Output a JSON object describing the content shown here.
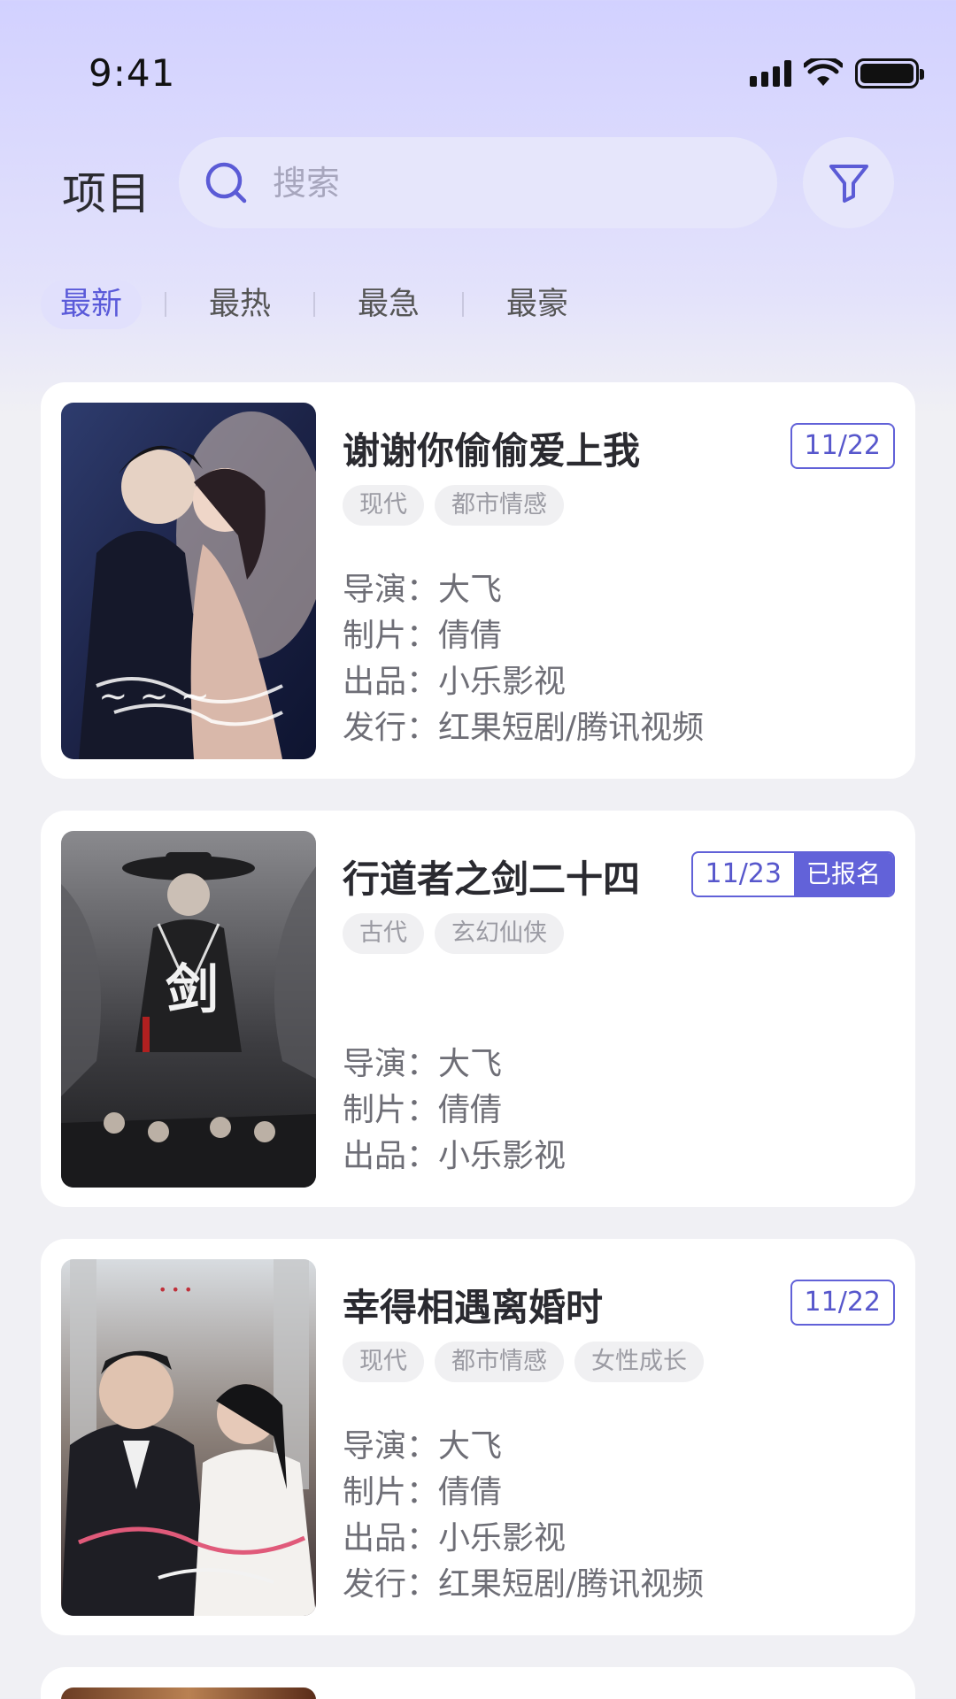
{
  "status_bar": {
    "time": "9:41"
  },
  "header": {
    "title": "项目",
    "search_placeholder": "搜索"
  },
  "tabs": [
    {
      "label": "最新",
      "active": true
    },
    {
      "label": "最热",
      "active": false
    },
    {
      "label": "最急",
      "active": false
    },
    {
      "label": "最豪",
      "active": false
    }
  ],
  "projects": [
    {
      "title": "谢谢你偷偷爱上我",
      "date": "11/22",
      "status": "",
      "tags": [
        "现代",
        "都市情感"
      ],
      "director_label": "导演：",
      "director": "大飞",
      "producer_label": "制片：",
      "producer": "倩倩",
      "studio_label": "出品：",
      "studio": "小乐影视",
      "distributor_label": "发行：",
      "distributor": "红果短剧/腾讯视频"
    },
    {
      "title": "行道者之剑二十四",
      "date": "11/23",
      "status": "已报名",
      "tags": [
        "古代",
        "玄幻仙侠"
      ],
      "director_label": "导演：",
      "director": "大飞",
      "producer_label": "制片：",
      "producer": "倩倩",
      "studio_label": "出品：",
      "studio": "小乐影视"
    },
    {
      "title": "幸得相遇离婚时",
      "date": "11/22",
      "status": "",
      "tags": [
        "现代",
        "都市情感",
        "女性成长"
      ],
      "director_label": "导演：",
      "director": "大飞",
      "producer_label": "制片：",
      "producer": "倩倩",
      "studio_label": "出品：",
      "studio": "小乐影视",
      "distributor_label": "发行：",
      "distributor": "红果短剧/腾讯视频"
    }
  ],
  "colors": {
    "accent": "#6262d9",
    "background_top": "#d2d1ff",
    "background": "#f0f0f4"
  }
}
